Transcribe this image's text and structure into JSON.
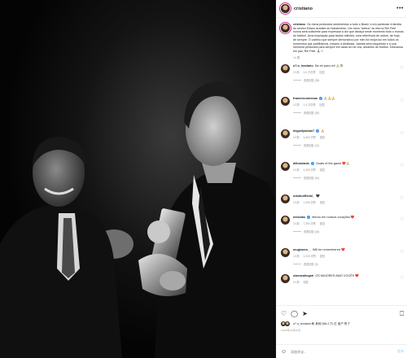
{
  "header": {
    "username": "cristiano",
    "more_icon": "more-horizontal-icon"
  },
  "caption": {
    "username": "cristiano",
    "text": "Os meus profundos sentimentos a todo o Brasil, e em particular à família do senhor Edson Arantes do Nascimento. Um mero \"adeus\" ao eterno Rei Pelé nunca será suficiente para expressar a dor que abraça neste momento todo o mundo do futebol. Uma inspiração para tantos milhões, uma referência de ontem, de hoje, de sempre. O carinho que sempre demonstrou por mim foi recíproco em todos os momentos que partilhámos, mesmo à distância. Jamais será esquecido e a sua memória perdurará para sempre em cada um de nós, amantes de futebol. Descansa em paz, Rei Pelé. 🙏🏽🕊️",
    "time": "14 周"
  },
  "comments": [
    {
      "username": "o7.o_lendario",
      "verified": false,
      "text": "Da rei para rei! 🙏😢",
      "time": "10 周",
      "likes": "1.8 万次赞",
      "reply": "回复",
      "replies": "查看回复 (35)"
    },
    {
      "username": "francescomecaa",
      "verified": true,
      "text": "🙏🙏🙏",
      "time": "12 周",
      "likes": "1.4 万次赞",
      "reply": "回复",
      "replies": "查看回复 (30)"
    },
    {
      "username": "miguelpaixao7",
      "verified": true,
      "text": "🙏",
      "time": "13 周",
      "likes": "4,402 次赞",
      "reply": "回复",
      "replies": "查看回复 (21)"
    },
    {
      "username": "dillondanis",
      "verified": true,
      "text": "Goats of the game ❤️🙏",
      "time": "14 周",
      "likes": "4,360 次赞",
      "reply": "回复",
      "replies": "查看回复 (61)"
    },
    {
      "username": "oduduofficial_",
      "verified": false,
      "text": "🖤",
      "time": "13 周",
      "likes": "1,005 次赞",
      "reply": "回复",
      "replies": ""
    },
    {
      "username": "nickolas",
      "verified": true,
      "text": "eterno em nossos corações ❤️",
      "time": "13 周",
      "likes": "7,390 次赞",
      "reply": "回复",
      "replies": "查看回复 (18)"
    },
    {
      "username": "mugiwera__",
      "verified": false,
      "text": "Will be remembered ❤️",
      "time": "13 周",
      "likes": "1,205 次赞",
      "reply": "回复",
      "replies": "查看回复 (3)"
    },
    {
      "username": "olavocallegari",
      "verified": false,
      "text": "OS MAIORES AMO VOCÊS ❤️",
      "time": "14 周",
      "likes": "",
      "reply": "回复",
      "replies": ""
    }
  ],
  "actions": {
    "like_icon": "heart-icon",
    "comment_icon": "comment-icon",
    "share_icon": "send-icon",
    "save_icon": "bookmark-icon"
  },
  "likes_text": "o7.o_lendario 和 其他 384.2 万 位 用户 赞了",
  "date_text": "2022年12月30日",
  "add_comment": {
    "placeholder": "添加评论...",
    "post_label": "发布",
    "emoji_icon": "smile-icon"
  },
  "colors": {
    "verified": "#3897f0",
    "post": "#b2dffc",
    "text": "#262626",
    "muted": "#8e8e8e"
  }
}
